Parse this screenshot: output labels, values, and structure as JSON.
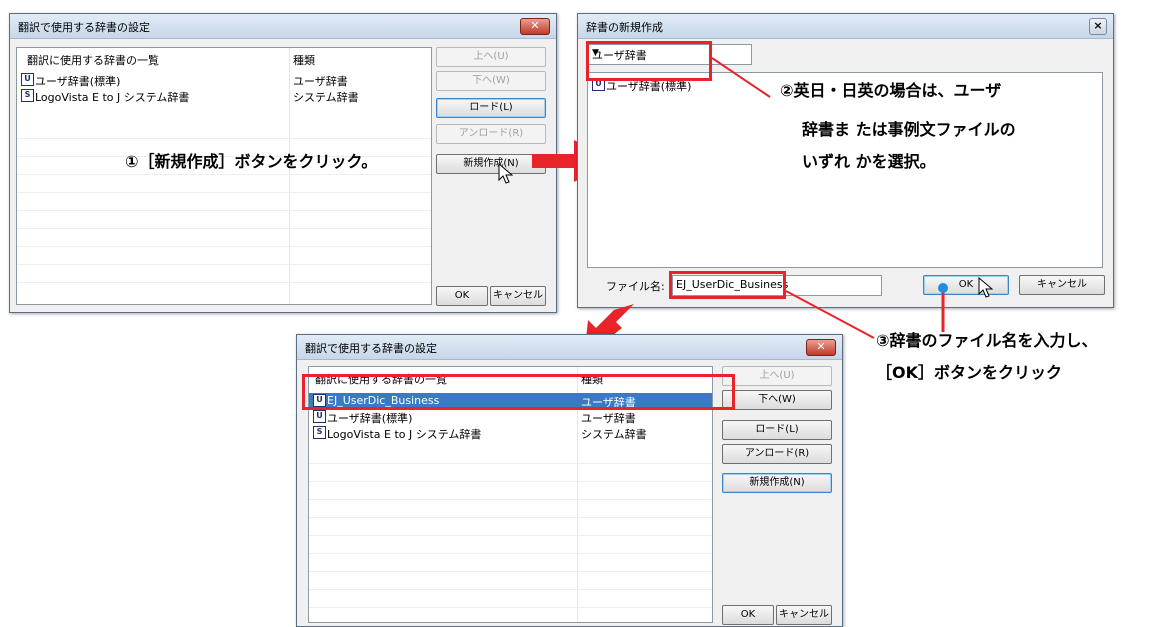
{
  "win1": {
    "title": "翻訳で使用する辞書の設定",
    "close": "✕",
    "header_name": "翻訳に使用する辞書の一覧",
    "header_type": "種類",
    "rows": [
      {
        "icon": "U",
        "name": "ユーザ辞書(標準)",
        "type": "ユーザ辞書"
      },
      {
        "icon": "S",
        "name": "LogoVista E to J システム辞書",
        "type": "システム辞書"
      }
    ],
    "buttons": {
      "up": "上へ(U)",
      "down": "下へ(W)",
      "load": "ロード(L)",
      "unload": "アンロード(R)",
      "new": "新規作成(N)",
      "ok": "OK",
      "cancel": "キャンセル"
    }
  },
  "win2": {
    "title": "辞書の新規作成",
    "close": "×",
    "dropdown_value": "ユーザ辞書",
    "dropdown_arrow": "▼",
    "list_item": {
      "icon": "U",
      "name": "ユーザ辞書(標準)"
    },
    "file_label": "ファイル名:",
    "file_value": "EJ_UserDic_Business",
    "ok": "OK",
    "cancel": "キャンセル"
  },
  "win3": {
    "title": "翻訳で使用する辞書の設定",
    "close": "✕",
    "header_name": "翻訳に使用する辞書の一覧",
    "header_type": "種類",
    "rows": [
      {
        "icon": "U",
        "name": "EJ_UserDic_Business",
        "type": "ユーザ辞書"
      },
      {
        "icon": "U",
        "name": "ユーザ辞書(標準)",
        "type": "ユーザ辞書"
      },
      {
        "icon": "S",
        "name": "LogoVista E to J システム辞書",
        "type": "システム辞書"
      }
    ],
    "buttons": {
      "up": "上へ(U)",
      "down": "下へ(W)",
      "load": "ロード(L)",
      "unload": "アンロード(R)",
      "new": "新規作成(N)",
      "ok": "OK",
      "cancel": "キャンセル"
    }
  },
  "callouts": {
    "step1": "①［新規作成］ボタンをクリック。",
    "step2_line1": "②英日・日英の場合は、ユーザ",
    "step2_line2": "辞書ま たは事例文ファイルの",
    "step2_line3": "いずれ かを選択。",
    "step3_line1": "③辞書のファイル名を入力し、",
    "step3_line2": "［OK］ボタンをクリック"
  },
  "colors": {
    "annotation_red": "#e8232a",
    "selection_blue": "#3b78c6"
  }
}
